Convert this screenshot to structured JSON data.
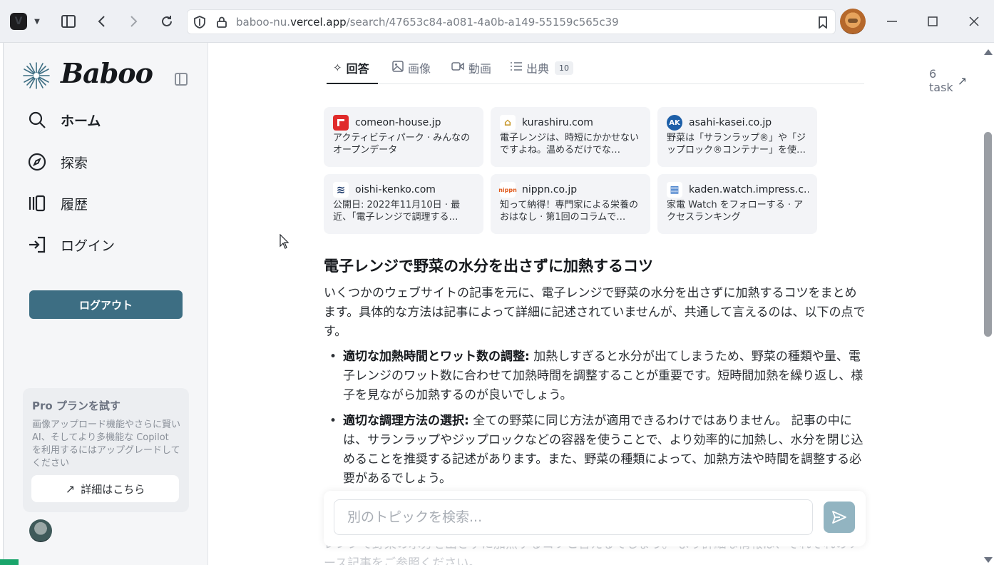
{
  "browser": {
    "url_prefix": "baboo-nu.",
    "url_domain": "vercel.app",
    "url_path": "/search/47653c84-a081-4a0b-a149-55159c565c39",
    "icons": [
      "vivaldi-logo",
      "panel-toggle-icon",
      "back-arrow-icon",
      "forward-arrow-icon",
      "reload-icon",
      "shield-icon",
      "lock-icon",
      "bookmark-icon",
      "profile-avatar",
      "minimize-icon",
      "maximize-icon",
      "close-icon"
    ]
  },
  "sidebar": {
    "logo_text": "Baboo",
    "nav": [
      {
        "label": "ホーム",
        "icon": "search-icon",
        "active": true
      },
      {
        "label": "探索",
        "icon": "compass-icon",
        "active": false
      },
      {
        "label": "履歴",
        "icon": "history-icon",
        "active": false
      },
      {
        "label": "ログイン",
        "icon": "login-icon",
        "active": false
      }
    ],
    "logout_label": "ログアウト",
    "pro": {
      "title": "Pro プランを試す",
      "description": "画像アップロード機能やさらに賢い AI、そしてより多機能な Copilot を利用するにはアップグレードしてください",
      "link_label": "詳細はこちら"
    },
    "accent_color": "#3d6e83"
  },
  "tabs": [
    {
      "label": "回答",
      "icon": "sparkle-icon",
      "active": true
    },
    {
      "label": "画像",
      "icon": "image-icon",
      "active": false
    },
    {
      "label": "動画",
      "icon": "video-icon",
      "active": false
    },
    {
      "label": "出典",
      "icon": "list-icon",
      "active": false,
      "count": "10"
    }
  ],
  "task_link": "6 task",
  "sources": [
    {
      "domain": "comeon-house.jp",
      "snippet": "アクティビティパーク · みんなのオープンデータ",
      "favicon_color": "#e02b2b",
      "favicon_text": ""
    },
    {
      "domain": "kurashiru.com",
      "snippet": "電子レンジは、時短にかかせないですよね。温めるだけでな…",
      "favicon_color": "#ffffff",
      "favicon_text": "⌂"
    },
    {
      "domain": "asahi-kasei.co.jp",
      "snippet": "野菜は「サランラップ®」や「ジップロック®コンテナー」を使…",
      "favicon_color": "#1d5fa8",
      "favicon_text": "AK"
    },
    {
      "domain": "oishi-kenko.com",
      "snippet": "公開日: 2022年11月10日 · 最近、「電子レンジで調理する…",
      "favicon_color": "#ffffff",
      "favicon_text": "≋"
    },
    {
      "domain": "nippn.co.jp",
      "snippet": "知って納得！専門家による栄養のおはなし · 第1回のコラムで…",
      "favicon_color": "#ffffff",
      "favicon_text": "nippn"
    },
    {
      "domain": "kaden.watch.impress.c...",
      "snippet": "家電 Watch をフォローする · アクセスランキング",
      "favicon_color": "#ffffff",
      "favicon_text": "▦"
    }
  ],
  "answer": {
    "title": "電子レンジで野菜の水分を出さずに加熱するコツ",
    "intro": "いくつかのウェブサイトの記事を元に、電子レンジで野菜の水分を出さずに加熱するコツをまとめます。具体的な方法は記事によって詳細に記述されていませんが、共通して言えるのは、以下の点です。",
    "points": [
      {
        "heading": "適切な加熱時間とワット数の調整:",
        "text": " 加熱しすぎると水分が出てしまうため、野菜の種類や量、電子レンジのワット数に合わせて加熱時間を調整することが重要です。短時間加熱を繰り返し、様子を見ながら加熱するのが良いでしょう。"
      },
      {
        "heading": "適切な調理方法の選択:",
        "text": " 全ての野菜に同じ方法が適用できるわけではありません。 記事の中には、サランラップやジップロックなどの容器を使うことで、より効率的に加熱し、水分を閉じ込めることを推奨する記述があります。また、野菜の種類によって、加熱方法や時間を調整する必要があるでしょう。"
      }
    ],
    "faded_text": "レンジで野菜の水分を出さずに加熱するコツと言えるでしょう。 より詳細な情報は、それぞれのソース記事をご参照ください。"
  },
  "search": {
    "placeholder": "別のトピックを検索...",
    "value": ""
  }
}
